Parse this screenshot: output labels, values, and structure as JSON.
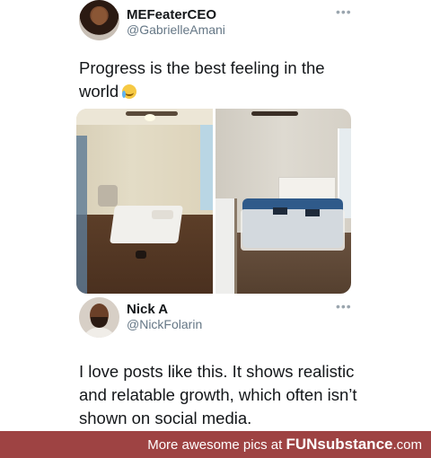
{
  "tweet1": {
    "name": "MEFeaterCEO",
    "handle": "@GabrielleAmani",
    "more": "•••",
    "text": "Progress is the best feeling in the world",
    "emoji": "loudly-crying-face"
  },
  "tweet2": {
    "name": "Nick A",
    "handle": "@NickFolarin",
    "more": "•••",
    "text": "I love posts like this. It shows realistic and relatable growth, which often isn’t shown on social media."
  },
  "footer": {
    "prefix": "More awesome pics at ",
    "brand": "FUNsubstance",
    "suffix": ".com"
  },
  "colors": {
    "footer_bg": "#9e4343",
    "handle": "#657786",
    "text": "#14171a"
  }
}
